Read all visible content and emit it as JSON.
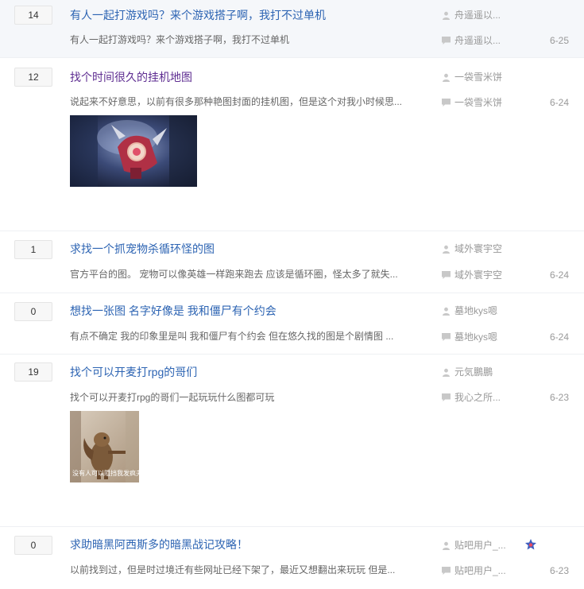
{
  "threads": [
    {
      "replies": "14",
      "title": "有人一起打游戏吗？来个游戏搭子啊，我打不过单机",
      "abstract": "有人一起打游戏吗？来个游戏搭子啊，我打不过单机",
      "author": "舟遥遥以...",
      "last_reply_user": "舟遥遥以...",
      "date": "6-25"
    },
    {
      "replies": "12",
      "title": "找个时间很久的挂机地图",
      "abstract": "说起来不好意思，以前有很多那种艳图封面的挂机图，但是这个对我小时候思...",
      "author": "一袋雪米饼",
      "last_reply_user": "一袋雪米饼",
      "date": "6-24",
      "thumb": "game-character-thumbnail"
    },
    {
      "replies": "1",
      "title": "求找一个抓宠物杀循环怪的图",
      "abstract": "官方平台的图。 宠物可以像英雄一样跑来跑去 应该是循环圈，怪太多了就失...",
      "author": "域外寰宇空",
      "last_reply_user": "域外寰宇空",
      "date": "6-24"
    },
    {
      "replies": "0",
      "title": "想找一张图 名字好像是 我和僵尸有个约会",
      "abstract": "有点不确定 我的印象里是叫 我和僵尸有个约会 但在悠久找的图是个剧情图 ...",
      "author": "墓地kys嗯",
      "last_reply_user": "墓地kys嗯",
      "date": "6-24"
    },
    {
      "replies": "19",
      "title": "找个可以开麦打rpg的哥们",
      "abstract": "找个可以开麦打rpg的哥们一起玩玩什么图都可玩",
      "author": "元気鵬鵬",
      "last_reply_user": "我心之所...",
      "date": "6-23",
      "thumb": "squirrel-photo-thumbnail",
      "thumb_caption": "没有人可以阻挡我发疯夫"
    },
    {
      "replies": "0",
      "title": "求助暗黑阿西斯多的暗黑战记攻略！",
      "abstract": "以前找到过，但是时过境迁有些网址已经下架了，最近又想翻出来玩玩 但是...",
      "author": "贴吧用户_...",
      "last_reply_user": "贴吧用户_...",
      "date": "6-23",
      "badge": "member-badge-icon"
    }
  ],
  "colors": {
    "title": "#2d64b3",
    "visited": "#5e2d91",
    "meta": "#999999",
    "highlight_bg": "#f5f7fa"
  }
}
